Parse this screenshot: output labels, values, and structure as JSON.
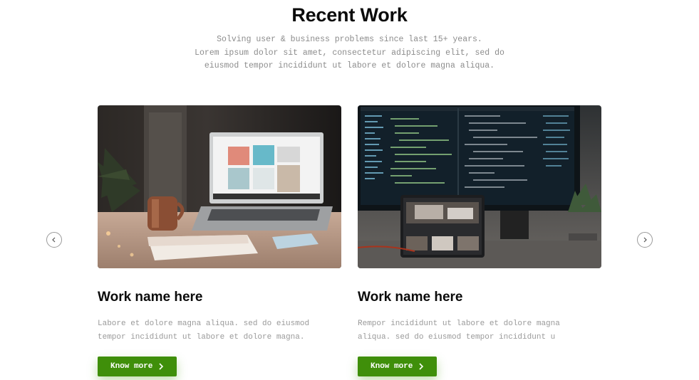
{
  "section": {
    "title": "Recent Work",
    "subtitle_lines": [
      "Solving user & business problems since last 15+ years.",
      "Lorem ipsum dolor sit amet, consectetur adipiscing elit, sed do",
      "eiusmod tempor incididunt ut labore et dolore magna aliqua."
    ]
  },
  "cards": [
    {
      "title": "Work name here",
      "text_lines": [
        "Labore et dolore magna aliqua. sed do eiusmod",
        "tempor incididunt ut labore et dolore magna."
      ],
      "button_label": "Know more"
    },
    {
      "title": "Work name here",
      "text_lines": [
        "Rempor incididunt ut labore et dolore magna",
        "aliqua. sed do eiusmod tempor incididunt u"
      ],
      "button_label": "Know more"
    }
  ],
  "colors": {
    "accent_green": "#3f8f0a",
    "heading": "#0b0b0b",
    "muted_text": "#9a9a9a"
  },
  "icons": {
    "prev": "chevron-left-icon",
    "next": "chevron-right-icon",
    "button": "chevron-right-icon"
  }
}
